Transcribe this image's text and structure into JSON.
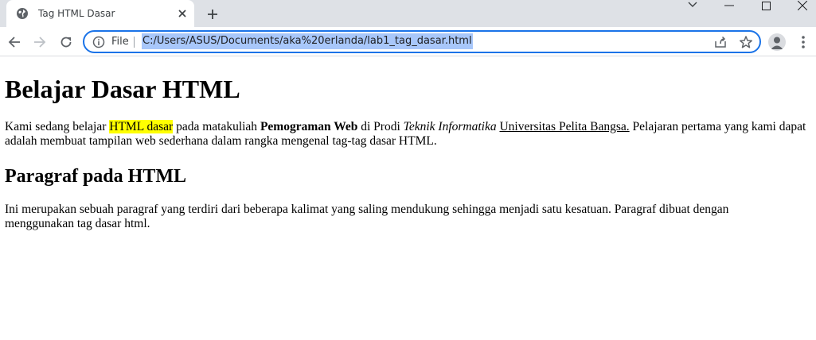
{
  "browser": {
    "tab": {
      "title": "Tag HTML Dasar",
      "favicon": "globe-icon"
    },
    "omnibox": {
      "security_label": "File",
      "url": "C:/Users/ASUS/Documents/aka%20erlanda/lab1_tag_dasar.html"
    },
    "icons": {
      "back": "arrow-left-icon",
      "forward": "arrow-right-icon",
      "reload": "reload-icon",
      "share": "share-icon",
      "bookmark": "star-icon",
      "menu": "kebab-menu-icon"
    },
    "colors": {
      "tabstrip_bg": "#dee1e6",
      "omnibox_focus": "#1a73e8",
      "url_selection": "#a8c7fa"
    }
  },
  "page": {
    "heading1": "Belajar Dasar HTML",
    "paragraph1": {
      "t1": "Kami sedang belajar ",
      "highlight": "HTML dasar",
      "t2": " pada matakuliah ",
      "bold": "Pemograman Web",
      "t3": " di Prodi ",
      "italic": "Teknik Informatika",
      "t4": " ",
      "underline": "Universitas Pelita Bangsa.",
      "t5": " Pelajaran pertama yang kami dapat adalah membuat tampilan web sederhana dalam rangka mengenal tag-tag dasar HTML."
    },
    "heading2": "Paragraf pada HTML",
    "paragraph2": "Ini merupakan sebuah paragraf yang terdiri dari beberapa kalimat yang saling mendukung sehingga menjadi satu kesatuan. Paragraf dibuat dengan menggunakan tag dasar html.",
    "colors": {
      "highlight": "#ffff00"
    }
  }
}
